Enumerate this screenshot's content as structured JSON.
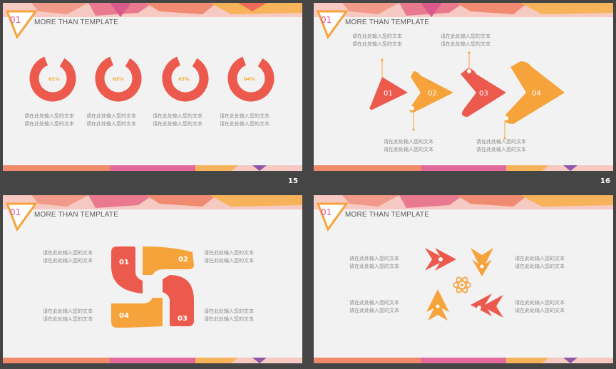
{
  "colors": {
    "red": "#ec5a4e",
    "orange": "#f5a33a",
    "badge_number": "#e0509a",
    "pink": "#e46a9c",
    "purple": "#8a5aa8",
    "page_bg": "#454545",
    "slide_bg": "#f2f2f2"
  },
  "slides": [
    {
      "badge": "01",
      "header": "MORE THAN TEMPLATE",
      "page_number": "15",
      "rings": [
        {
          "label": "01%"
        },
        {
          "label": "02%"
        },
        {
          "label": "03%"
        },
        {
          "label": "04%"
        }
      ],
      "captions": [
        {
          "line1": "请在此处输入您的文本",
          "line2": "请在此处输入您的文本"
        },
        {
          "line1": "请在此处输入您的文本",
          "line2": "请在此处输入您的文本"
        },
        {
          "line1": "请在此处输入您的文本",
          "line2": "请在此处输入您的文本"
        },
        {
          "line1": "请在此处输入您的文本",
          "line2": "请在此处输入您的文本"
        }
      ]
    },
    {
      "badge": "01",
      "header": "MORE THAN TEMPLATE",
      "page_number": "16",
      "arrows": [
        {
          "label": "01"
        },
        {
          "label": "02"
        },
        {
          "label": "03"
        },
        {
          "label": "04"
        }
      ],
      "captions": [
        {
          "line1": "请在此处输入您的文本",
          "line2": "请在此处输入您的文本"
        },
        {
          "line1": "请在此处输入您的文本",
          "line2": "请在此处输入您的文本"
        },
        {
          "line1": "请在此处输入您的文本",
          "line2": "请在此处输入您的文本"
        },
        {
          "line1": "请在此处输入您的文本",
          "line2": "请在此处输入您的文本"
        }
      ]
    },
    {
      "badge": "01",
      "header": "MORE THAN TEMPLATE",
      "blocks": [
        {
          "label": "01"
        },
        {
          "label": "02"
        },
        {
          "label": "03"
        },
        {
          "label": "04"
        }
      ],
      "captions": [
        {
          "line1": "请在此处输入您的文本",
          "line2": "请在此处输入您的文本"
        },
        {
          "line1": "请在此处输入您的文本",
          "line2": "请在此处输入您的文本"
        },
        {
          "line1": "请在此处输入您的文本",
          "line2": "请在此处输入您的文本"
        },
        {
          "line1": "请在此处输入您的文本",
          "line2": "请在此处输入您的文本"
        }
      ]
    },
    {
      "badge": "01",
      "header": "MORE THAN TEMPLATE",
      "center_icon": "atom-icon",
      "captions": [
        {
          "line1": "请在此处输入您的文本",
          "line2": "请在此处输入您的文本"
        },
        {
          "line1": "请在此处输入您的文本",
          "line2": "请在此处输入您的文本"
        },
        {
          "line1": "请在此处输入您的文本",
          "line2": "请在此处输入您的文本"
        },
        {
          "line1": "请在此处输入您的文本",
          "line2": "请在此处输入您的文本"
        }
      ]
    }
  ]
}
